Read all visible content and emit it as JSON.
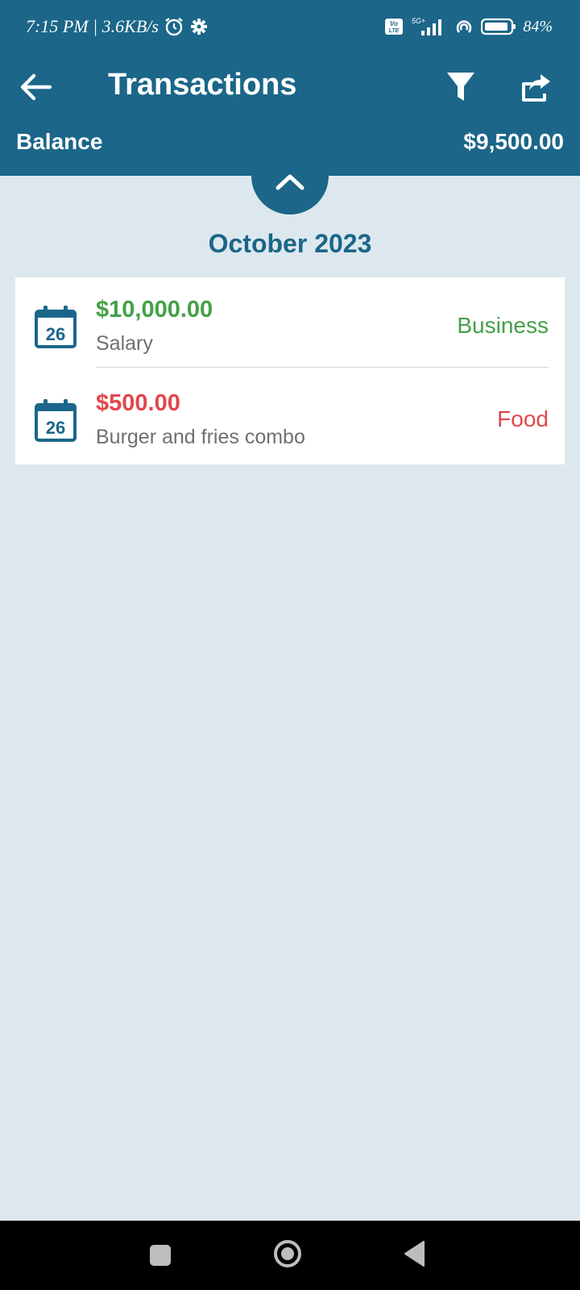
{
  "status": {
    "time": "7:15 PM",
    "net_speed": "3.6KB/s",
    "volte": "Vo LTE",
    "network": "5G+",
    "battery": "84%"
  },
  "appbar": {
    "title": "Transactions",
    "balance_label": "Balance",
    "balance_value": "$9,500.00"
  },
  "month_header": "October 2023",
  "transactions": [
    {
      "day": "26",
      "amount": "$10,000.00",
      "description": "Salary",
      "category": "Business",
      "type": "income"
    },
    {
      "day": "26",
      "amount": "$500.00",
      "description": "Burger and fries combo",
      "category": "Food",
      "type": "expense"
    }
  ],
  "colors": {
    "primary": "#1b6689",
    "background": "#dde8ee",
    "income": "#43a047",
    "expense": "#e0474c"
  },
  "icons": {
    "back": "arrow-left-icon",
    "filter": "filter-icon",
    "share": "share-icon",
    "collapse": "chevron-up-icon",
    "calendar": "calendar-icon"
  }
}
